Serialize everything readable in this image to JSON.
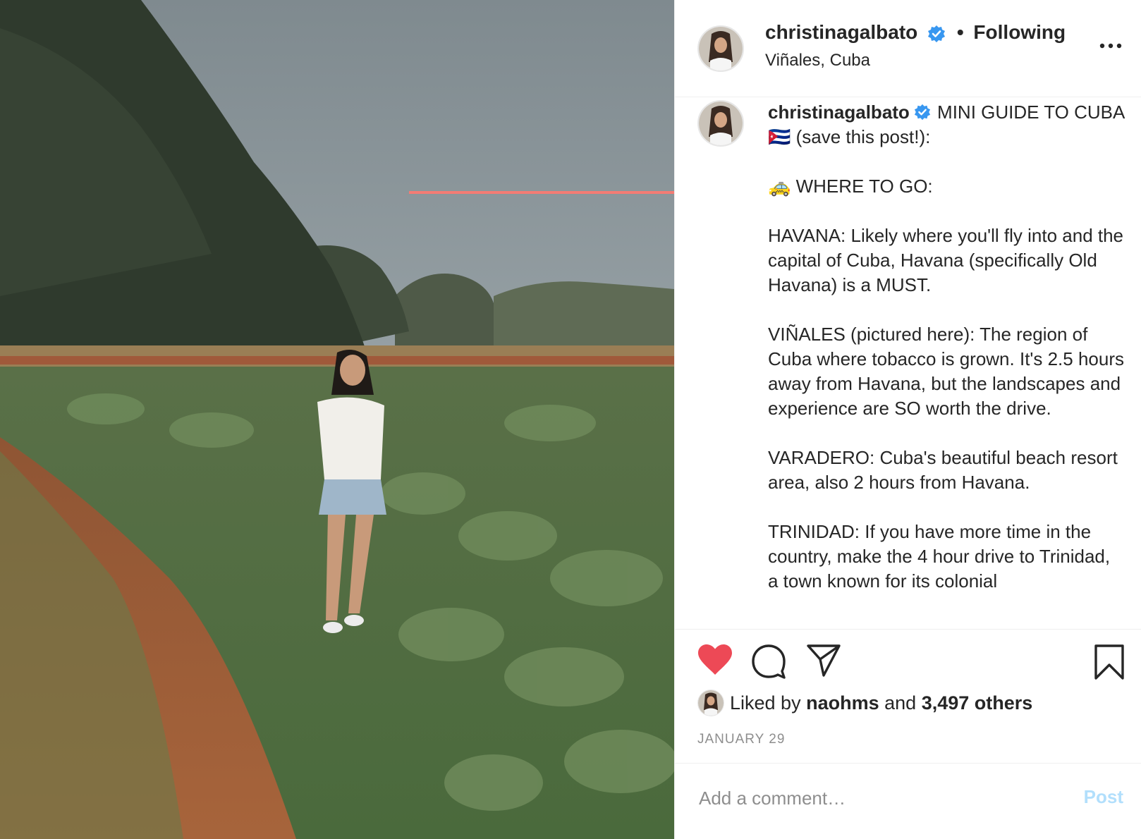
{
  "post": {
    "author": {
      "username": "christinagalbato",
      "verified": true,
      "follow_status": "Following",
      "location": "Viñales, Cuba"
    },
    "caption": {
      "username": "christinagalbato",
      "text": " MINI GUIDE TO CUBA 🇨🇺 (save this post!):\n\n🚕 WHERE TO GO:\n\nHAVANA: Likely where you'll fly into and the capital of Cuba, Havana (specifically Old Havana) is a MUST.\n\nVIÑALES (pictured here): The region of Cuba where tobacco is grown. It's 2.5 hours away from Havana, but the landscapes and experience are SO worth the drive.\n\nVARADERO: Cuba's beautiful beach resort area, also 2 hours from Havana.\n\nTRINIDAD: If you have more time in the country, make the 4 hour drive to Trinidad, a town known for its colonial"
    },
    "liked": true,
    "likes": {
      "prefix": "Liked by",
      "liked_by_user": "naohms",
      "conjunction": "and",
      "others": "3,497 others"
    },
    "date": "JANUARY 29",
    "comment_box": {
      "placeholder": "Add a comment…",
      "post_label": "Post"
    }
  },
  "icons": {
    "like": "heart-filled",
    "comment": "speech-bubble",
    "share": "paper-plane",
    "save": "bookmark",
    "more": "ellipsis"
  },
  "colors": {
    "like_red": "#ed4956",
    "verified_blue": "#3897f0",
    "post_button_disabled": "#b2dffc",
    "annotation_arrow": "#f47c74",
    "muted_text": "#8e8e8e"
  }
}
